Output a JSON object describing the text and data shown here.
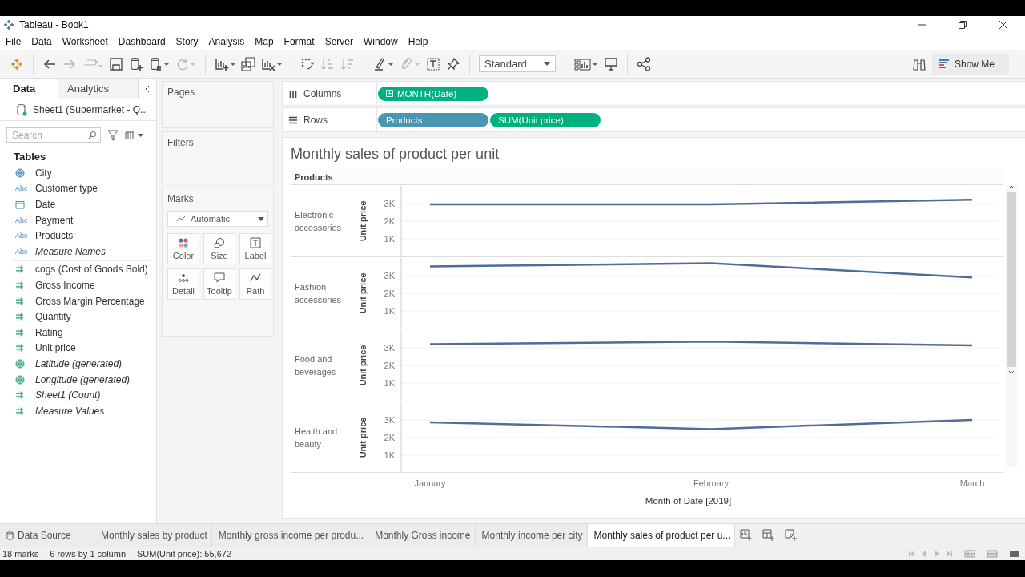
{
  "window": {
    "title": "Tableau - Book1"
  },
  "menu": [
    "File",
    "Data",
    "Worksheet",
    "Dashboard",
    "Story",
    "Analysis",
    "Map",
    "Format",
    "Server",
    "Window",
    "Help"
  ],
  "toolbar": {
    "fit": "Standard",
    "show_me": "Show Me"
  },
  "data_pane": {
    "tabs": [
      {
        "label": "Data",
        "selected": true
      },
      {
        "label": "Analytics",
        "selected": false
      }
    ],
    "data_source": "Sheet1 (Supermarket - Q...",
    "search": {
      "placeholder": "Search"
    },
    "tables_heading": "Tables",
    "fields": [
      {
        "name": "City",
        "kind": "geo_dimension",
        "italic": false
      },
      {
        "name": "Customer type",
        "kind": "string_dimension",
        "type_text": "Abc",
        "italic": false
      },
      {
        "name": "Date",
        "kind": "date_dimension",
        "italic": false
      },
      {
        "name": "Payment",
        "kind": "string_dimension",
        "type_text": "Abc",
        "italic": false
      },
      {
        "name": "Products",
        "kind": "string_dimension",
        "type_text": "Abc",
        "italic": false
      },
      {
        "name": "Measure Names",
        "kind": "string_dimension",
        "type_text": "Abc",
        "italic": true
      },
      {
        "name": "cogs (Cost of Goods Sold)",
        "kind": "number_measure",
        "italic": false
      },
      {
        "name": "Gross Income",
        "kind": "number_measure",
        "italic": false
      },
      {
        "name": "Gross Margin Percentage",
        "kind": "number_measure",
        "italic": false
      },
      {
        "name": "Quantity",
        "kind": "number_measure",
        "italic": false
      },
      {
        "name": "Rating",
        "kind": "number_measure",
        "italic": false
      },
      {
        "name": "Unit price",
        "kind": "number_measure",
        "italic": false
      },
      {
        "name": "Latitude (generated)",
        "kind": "geo_measure",
        "italic": true
      },
      {
        "name": "Longitude (generated)",
        "kind": "geo_measure",
        "italic": true
      },
      {
        "name": "Sheet1 (Count)",
        "kind": "number_measure",
        "italic": true
      },
      {
        "name": "Measure Values",
        "kind": "number_measure",
        "italic": true
      }
    ]
  },
  "cards": {
    "pages": "Pages",
    "filters": "Filters",
    "marks": {
      "title": "Marks",
      "mark_type": "Automatic",
      "buttons": [
        {
          "label": "Color",
          "kind": "color"
        },
        {
          "label": "Size",
          "kind": "size"
        },
        {
          "label": "Label",
          "kind": "label"
        },
        {
          "label": "Detail",
          "kind": "detail"
        },
        {
          "label": "Tooltip",
          "kind": "tooltip"
        },
        {
          "label": "Path",
          "kind": "path"
        }
      ]
    }
  },
  "shelves": [
    {
      "label": "Columns",
      "kind": "columns",
      "pills": [
        {
          "text": "MONTH(Date)",
          "kind": "continuous",
          "expandable": true
        }
      ]
    },
    {
      "label": "Rows",
      "kind": "rows",
      "pills": [
        {
          "text": "Products",
          "kind": "discrete",
          "expandable": false
        },
        {
          "text": "SUM(Unit price)",
          "kind": "continuous",
          "expandable": false
        }
      ]
    }
  ],
  "view": {
    "title": "Monthly sales of product per unit",
    "row_header": "Products",
    "panes": [
      {
        "label": "Electronic accessories",
        "chart_data": {
          "type": "line",
          "ylabel": "Unit price",
          "grid": true,
          "ylim": [
            0,
            4000
          ],
          "yticks": [
            {
              "value": 1000,
              "label": "1K"
            },
            {
              "value": 2000,
              "label": "2K"
            },
            {
              "value": 3000,
              "label": "3K"
            }
          ],
          "series": [
            {
              "color": "#4e6e96",
              "values": [
                2950,
                2950,
                3220
              ]
            }
          ]
        }
      },
      {
        "label": "Fashion accessories",
        "chart_data": {
          "type": "line",
          "ylabel": "Unit price",
          "grid": true,
          "ylim": [
            0,
            4000
          ],
          "yticks": [
            {
              "value": 1000,
              "label": "1K"
            },
            {
              "value": 2000,
              "label": "2K"
            },
            {
              "value": 3000,
              "label": "3K"
            }
          ],
          "series": [
            {
              "color": "#4e6e96",
              "values": [
                3520,
                3700,
                2900
              ]
            }
          ]
        }
      },
      {
        "label": "Food and beverages",
        "chart_data": {
          "type": "line",
          "ylabel": "Unit price",
          "grid": true,
          "ylim": [
            0,
            4000
          ],
          "yticks": [
            {
              "value": 1000,
              "label": "1K"
            },
            {
              "value": 2000,
              "label": "2K"
            },
            {
              "value": 3000,
              "label": "3K"
            }
          ],
          "series": [
            {
              "color": "#4e6e96",
              "values": [
                3200,
                3350,
                3130
              ]
            }
          ]
        }
      },
      {
        "label": "Health and beauty",
        "chart_data": {
          "type": "line",
          "ylabel": "Unit price",
          "grid": true,
          "ylim": [
            0,
            4000
          ],
          "yticks": [
            {
              "value": 1000,
              "label": "1K"
            },
            {
              "value": 2000,
              "label": "2K"
            },
            {
              "value": 3000,
              "label": "3K"
            }
          ],
          "series": [
            {
              "color": "#4e6e96",
              "values": [
                2870,
                2480,
                3000
              ]
            }
          ]
        }
      }
    ],
    "x_labels": [
      "January",
      "February",
      "March"
    ],
    "x_title": "Month of Date [2019]"
  },
  "sheet_tabs": [
    {
      "label": "Data Source",
      "kind": "data_source",
      "selected": false
    },
    {
      "label": "Monthly sales by product",
      "kind": "sheet",
      "selected": false
    },
    {
      "label": "Monthly gross income per produ...",
      "kind": "sheet",
      "selected": false
    },
    {
      "label": "Monthly Gross income",
      "kind": "sheet",
      "selected": false
    },
    {
      "label": "Monthly income per city",
      "kind": "sheet",
      "selected": false
    },
    {
      "label": "Monthly sales of product per u...",
      "kind": "sheet",
      "selected": true
    }
  ],
  "status_bar": [
    "18 marks",
    "6 rows by 1 column",
    "SUM(Unit price): 55,672"
  ]
}
